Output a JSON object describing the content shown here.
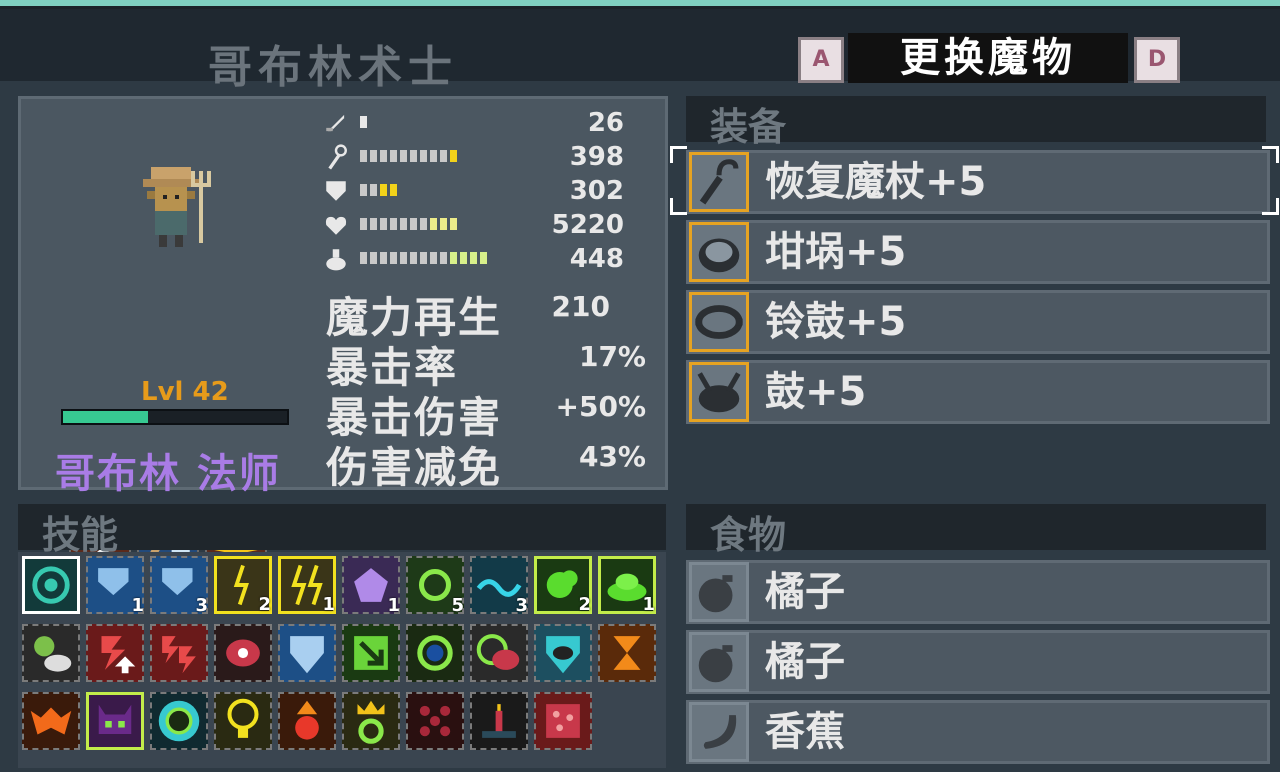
{
  "header": {
    "title": "哥布林术士",
    "prev_key": "A",
    "next_key": "D",
    "change_label": "更换魔物"
  },
  "monster": {
    "level": "Lvl 42",
    "xp_fraction": 0.38,
    "name": "哥布林 法师"
  },
  "stats": [
    {
      "icon": "sword-icon",
      "value": "26"
    },
    {
      "icon": "staff-icon",
      "value": "398"
    },
    {
      "icon": "shield-icon",
      "value": "302"
    },
    {
      "icon": "heart-icon",
      "value": "5220"
    },
    {
      "icon": "flask-icon",
      "value": "448"
    }
  ],
  "bigstats": [
    {
      "label": "魔力再生",
      "value": "210"
    },
    {
      "label": "暴击率",
      "value": "17%"
    },
    {
      "label": "暴击伤害",
      "value": "+50%"
    },
    {
      "label": "伤害减免",
      "value": "43%"
    }
  ],
  "sections": {
    "equipment": "装备",
    "skills": "技能",
    "food": "食物"
  },
  "equipment": [
    {
      "name": "恢复魔杖+5",
      "icon": "staff-icon"
    },
    {
      "name": "坩埚+5",
      "icon": "cauldron-icon"
    },
    {
      "name": "铃鼓+5",
      "icon": "tambourine-icon"
    },
    {
      "name": "鼓+5",
      "icon": "drum-icon"
    }
  ],
  "food": [
    {
      "name": "橘子",
      "icon": "orange-icon"
    },
    {
      "name": "橘子",
      "icon": "orange-icon"
    },
    {
      "name": "香蕉",
      "icon": "banana-icon"
    }
  ],
  "skills": {
    "row1": [
      {
        "icon": "vortex-icon",
        "level": ""
      },
      {
        "icon": "shield-swap-icon",
        "level": "1"
      },
      {
        "icon": "shield-swap-icon",
        "level": "3"
      },
      {
        "icon": "lightning-icon",
        "level": "2"
      },
      {
        "icon": "lightning-icon",
        "level": "1"
      },
      {
        "icon": "pentagon-icon",
        "level": "1"
      },
      {
        "icon": "target-icon",
        "level": "5"
      },
      {
        "icon": "wave-icon",
        "level": "3"
      },
      {
        "icon": "poison-cloud-icon",
        "level": "2"
      },
      {
        "icon": "slime-icon",
        "level": "1"
      }
    ],
    "colors": {
      "accent": "#e6a322",
      "xp": "#37c992",
      "name": "#a97ce6",
      "level": "#e79b1a"
    }
  }
}
